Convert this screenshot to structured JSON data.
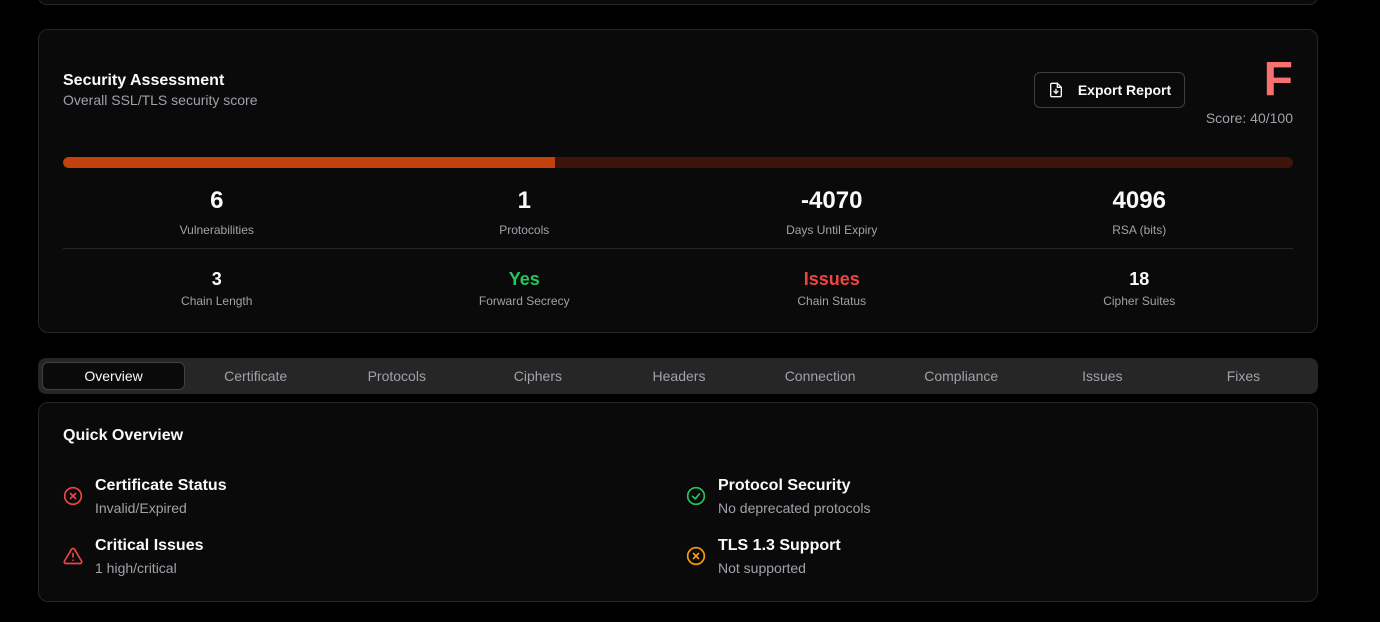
{
  "assessment": {
    "title": "Security Assessment",
    "subtitle": "Overall SSL/TLS security score",
    "export_label": "Export Report",
    "grade": "F",
    "score_text": "Score: 40/100",
    "score_fraction": 0.4,
    "colors": {
      "grade": "#f87171",
      "progress_fill": "#c2410c",
      "progress_track": "#3d140a"
    },
    "stats_primary": [
      {
        "value": "6",
        "label": "Vulnerabilities"
      },
      {
        "value": "1",
        "label": "Protocols"
      },
      {
        "value": "-4070",
        "label": "Days Until Expiry"
      },
      {
        "value": "4096",
        "label": "RSA (bits)"
      }
    ],
    "stats_secondary": [
      {
        "value": "3",
        "label": "Chain Length"
      },
      {
        "value": "Yes",
        "label": "Forward Secrecy",
        "color": "#22c55e"
      },
      {
        "value": "Issues",
        "label": "Chain Status",
        "color": "#ef4444"
      },
      {
        "value": "18",
        "label": "Cipher Suites"
      }
    ]
  },
  "tabs": [
    {
      "label": "Overview",
      "active": true
    },
    {
      "label": "Certificate"
    },
    {
      "label": "Protocols"
    },
    {
      "label": "Ciphers"
    },
    {
      "label": "Headers"
    },
    {
      "label": "Connection"
    },
    {
      "label": "Compliance"
    },
    {
      "label": "Issues"
    },
    {
      "label": "Fixes"
    }
  ],
  "overview": {
    "title": "Quick Overview",
    "items": [
      {
        "name": "Certificate Status",
        "desc": "Invalid/Expired",
        "icon": "x-circle-icon",
        "color": "#ef4444"
      },
      {
        "name": "Critical Issues",
        "desc": "1 high/critical",
        "icon": "alert-triangle-icon",
        "color": "#ef4444"
      },
      {
        "name": "Protocol Security",
        "desc": "No deprecated protocols",
        "icon": "check-circle-icon",
        "color": "#22c55e"
      },
      {
        "name": "TLS 1.3 Support",
        "desc": "Not supported",
        "icon": "x-circle-icon",
        "color": "#f59e0b"
      }
    ]
  }
}
